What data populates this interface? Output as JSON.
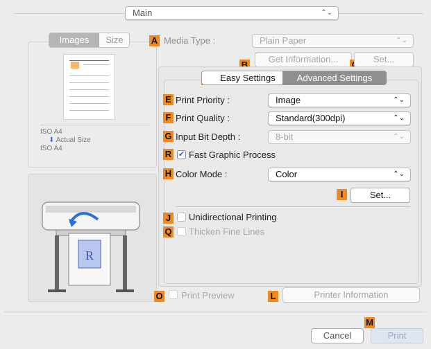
{
  "main_select": {
    "value": "Main"
  },
  "left_tabs": {
    "images": "Images",
    "size": "Size"
  },
  "media_type": {
    "label": "Media Type :",
    "value": "Plain Paper"
  },
  "info_buttons": {
    "get_information": "Get Information...",
    "set": "Set..."
  },
  "settings_tabs": {
    "easy": "Easy Settings",
    "advanced": "Advanced Settings"
  },
  "print_priority": {
    "label": "Print Priority :",
    "value": "Image"
  },
  "print_quality": {
    "label": "Print Quality :",
    "value": "Standard(300dpi)"
  },
  "input_bit_depth": {
    "label": "Input Bit Depth :",
    "value": "8-bit"
  },
  "fast_graphic": {
    "label": "Fast Graphic Process"
  },
  "color_mode": {
    "label": "Color Mode :",
    "value": "Color"
  },
  "color_set": {
    "label": "Set..."
  },
  "unidirectional": {
    "label": "Unidirectional Printing"
  },
  "thicken_lines": {
    "label": "Thicken Fine Lines"
  },
  "preview_info": {
    "size_from": "ISO A4",
    "actual_size": "Actual Size",
    "size_to": "ISO A4"
  },
  "print_preview": {
    "label": "Print Preview"
  },
  "printer_information": {
    "label": "Printer Information"
  },
  "footer": {
    "cancel": "Cancel",
    "print": "Print"
  },
  "badges": {
    "A": "A",
    "B": "B",
    "C": "C",
    "D": "D",
    "E": "E",
    "F": "F",
    "G": "G",
    "R": "R",
    "H": "H",
    "I": "I",
    "J": "J",
    "Q": "Q",
    "O": "O",
    "L": "L",
    "M": "M"
  },
  "colors": {
    "badge": "#f08a1c",
    "accent_blue": "#2f6fd6",
    "tab_active": "#8f8f8f"
  }
}
